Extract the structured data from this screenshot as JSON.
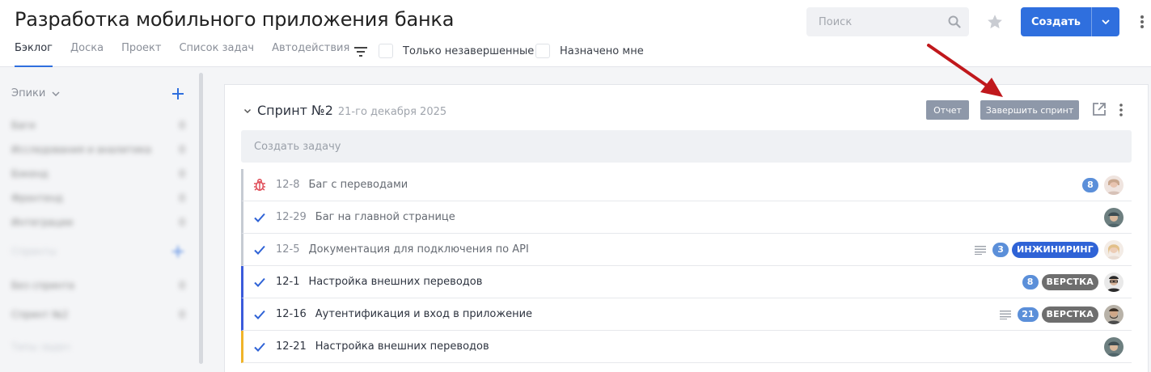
{
  "page": {
    "title": "Разработка мобильного приложения банка",
    "tabs": [
      "Бэклог",
      "Доска",
      "Проект",
      "Список задач",
      "Автодействия"
    ],
    "active_tab": "Бэклог",
    "filters": {
      "only_unfinished": "Только незавершенные",
      "assigned_to_me": "Назначено мне"
    },
    "search_placeholder": "Поиск",
    "create_label": "Создать"
  },
  "sidebar": {
    "epics_label": "Эпики",
    "epics": [
      {
        "name": "Баги",
        "count": "0"
      },
      {
        "name": "Исследования и аналитика",
        "count": "0"
      },
      {
        "name": "Бэкенд",
        "count": "0"
      },
      {
        "name": "Фронтенд",
        "count": "0"
      },
      {
        "name": "Интеграции",
        "count": "0"
      }
    ],
    "sprints_label": "Спринты",
    "sprints": [
      {
        "name": "Без спринта",
        "count": "0"
      },
      {
        "name": "Спринт №2",
        "count": "0"
      }
    ],
    "types_label": "Типы задач"
  },
  "sprint": {
    "title": "Спринт №2",
    "date": "21-го декабря 2025",
    "report_label": "Отчет",
    "complete_label": "Завершить спринт",
    "create_task_placeholder": "Создать задачу",
    "issues": [
      {
        "type": "bug-icon",
        "key": "12-8",
        "summary": "Баг с переводами",
        "points": "8",
        "label": "",
        "description": false,
        "status_color": "#c6cbd3",
        "avatar": "avatar-woman-light"
      },
      {
        "type": "check-icon",
        "key": "12-29",
        "summary": "Баг на главной странице",
        "points": "",
        "label": "",
        "description": false,
        "status_color": "#c6cbd3",
        "avatar": "avatar-man-cap"
      },
      {
        "type": "check-icon",
        "key": "12-5",
        "summary": "Документация для подключения по API",
        "points": "3",
        "label": "ИНЖИНИРИНГ",
        "label_color": "#2f63d6",
        "description": true,
        "status_color": "#c6cbd3",
        "avatar": "avatar-woman-blonde"
      },
      {
        "type": "check-icon",
        "key": "12-1",
        "summary": "Настройка внешних переводов",
        "points": "8",
        "label": "ВЕРСТКА",
        "label_color": "#6e6e6e",
        "description": false,
        "status_color": "#3b5bdb",
        "avatar": "avatar-man-glasses"
      },
      {
        "type": "check-icon",
        "key": "12-16",
        "summary": "Аутентификация и вход в приложение",
        "points": "21",
        "label": "ВЕРСТКА",
        "label_color": "#6e6e6e",
        "description": true,
        "status_color": "#3b5bdb",
        "avatar": "avatar-man-beard"
      },
      {
        "type": "check-icon",
        "key": "12-21",
        "summary": "Настройка внешних переводов",
        "points": "",
        "label": "",
        "description": false,
        "status_color": "#f0b429",
        "avatar": "avatar-man-cap"
      }
    ]
  },
  "colors": {
    "accent": "#2f6fde",
    "button_gray": "#8e98a9",
    "arrow": "#c0181c"
  }
}
